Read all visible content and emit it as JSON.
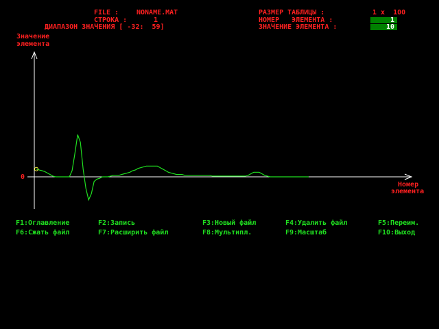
{
  "header": {
    "file_label": "FILE :",
    "file_value": "NONAME.MAT",
    "row_label": "СТРОКА :",
    "row_value": "1",
    "range_label": "ДИАПАЗОН ЗНАЧЕНИЯ [ -32:  59]",
    "table_size_label": "РАЗМЕР ТАБЛИЦЫ :",
    "table_size_value": "1 x  100",
    "element_number_label": "НОМЕР   ЭЛЕМЕНТА :",
    "element_number_value": "1",
    "element_value_label": "ЗНАЧЕНИЕ ЭЛЕМЕНТА :",
    "element_value_value": "10"
  },
  "plot": {
    "y_axis_label_1": "Значение",
    "y_axis_label_2": "элемента",
    "x_axis_label_1": "Номер",
    "x_axis_label_2": "элемента",
    "zero_label": "0",
    "colors": {
      "line": "#20e020",
      "axes": "#ffffff",
      "marker": "#ffff40"
    }
  },
  "chart_data": {
    "type": "line",
    "x_range": [
      1,
      100
    ],
    "y_range": [
      -32,
      59
    ],
    "y_tick_labels": [
      "0"
    ],
    "selected_index": 1,
    "values": [
      10,
      9,
      8,
      7,
      5,
      3,
      1,
      0,
      0,
      0,
      0,
      0,
      0,
      8,
      30,
      55,
      45,
      10,
      -15,
      -30,
      -22,
      -6,
      -3,
      -2,
      0,
      0,
      0,
      1,
      2,
      2,
      2,
      3,
      4,
      5,
      6,
      8,
      9,
      11,
      12,
      13,
      14,
      14,
      14,
      14,
      14,
      12,
      10,
      8,
      6,
      5,
      4,
      3,
      3,
      3,
      2,
      2,
      2,
      2,
      2,
      2,
      2,
      2,
      2,
      2,
      1,
      1,
      1,
      1,
      1,
      1,
      1,
      1,
      1,
      1,
      1,
      1,
      1,
      2,
      4,
      6,
      6,
      6,
      4,
      2,
      1,
      0,
      0,
      0,
      0,
      0,
      0,
      0,
      0,
      0,
      0,
      0,
      0,
      0,
      0,
      0
    ]
  },
  "function_keys": [
    {
      "id": "f1",
      "label": "F1:Оглавление"
    },
    {
      "id": "f2",
      "label": "F2:Запись"
    },
    {
      "id": "f3",
      "label": "F3:Новый файл"
    },
    {
      "id": "f4",
      "label": "F4:Удалить файл"
    },
    {
      "id": "f5",
      "label": "F5:Переим."
    },
    {
      "id": "f6",
      "label": "F6:Сжать файл"
    },
    {
      "id": "f7",
      "label": "F7:Расширить файл"
    },
    {
      "id": "f8",
      "label": "F8:Мультипл."
    },
    {
      "id": "f9",
      "label": "F9:Масштаб"
    },
    {
      "id": "f10",
      "label": "F10:Выход"
    }
  ]
}
